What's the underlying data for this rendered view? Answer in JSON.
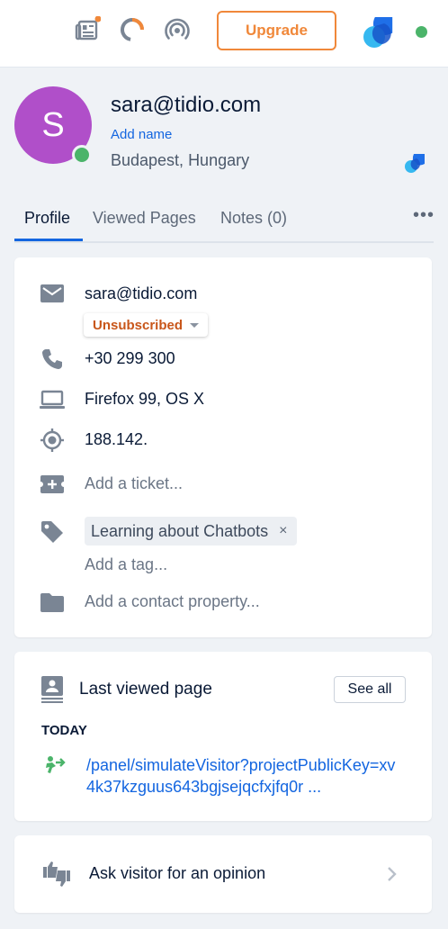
{
  "topbar": {
    "icons": [
      "newspaper-icon",
      "loading-ring-icon",
      "broadcast-icon"
    ],
    "upgrade_label": "Upgrade",
    "status": "online"
  },
  "profile": {
    "avatar_initial": "S",
    "email": "sara@tidio.com",
    "add_name_label": "Add name",
    "location": "Budapest, Hungary"
  },
  "tabs": [
    {
      "label": "Profile",
      "active": true
    },
    {
      "label": "Viewed Pages",
      "active": false
    },
    {
      "label": "Notes (0)",
      "active": false
    }
  ],
  "tabs_more_label": "•••",
  "contact": {
    "email": "sara@tidio.com",
    "subscription_status": "Unsubscribed",
    "phone": "+30 299 300",
    "browser": "Firefox 99, OS X",
    "ip": "188.142.",
    "add_ticket_label": "Add a ticket...",
    "tags": [
      "Learning about Chatbots"
    ],
    "tag_remove_symbol": "×",
    "add_tag_label": "Add a tag...",
    "add_property_label": "Add a contact property..."
  },
  "last_viewed": {
    "title": "Last viewed page",
    "see_all_label": "See all",
    "day_label": "TODAY",
    "url": "/panel/simulateVisitor?projectPublicKey=xv4k37kzguus643bgjsejqcfxjfq0r ..."
  },
  "opinion": {
    "label": "Ask visitor for an opinion"
  },
  "colors": {
    "accent": "#1466e0",
    "upgrade": "#f0883a",
    "avatar": "#b04fc9",
    "online": "#4bb46a",
    "unsubscribed": "#c8561a"
  }
}
